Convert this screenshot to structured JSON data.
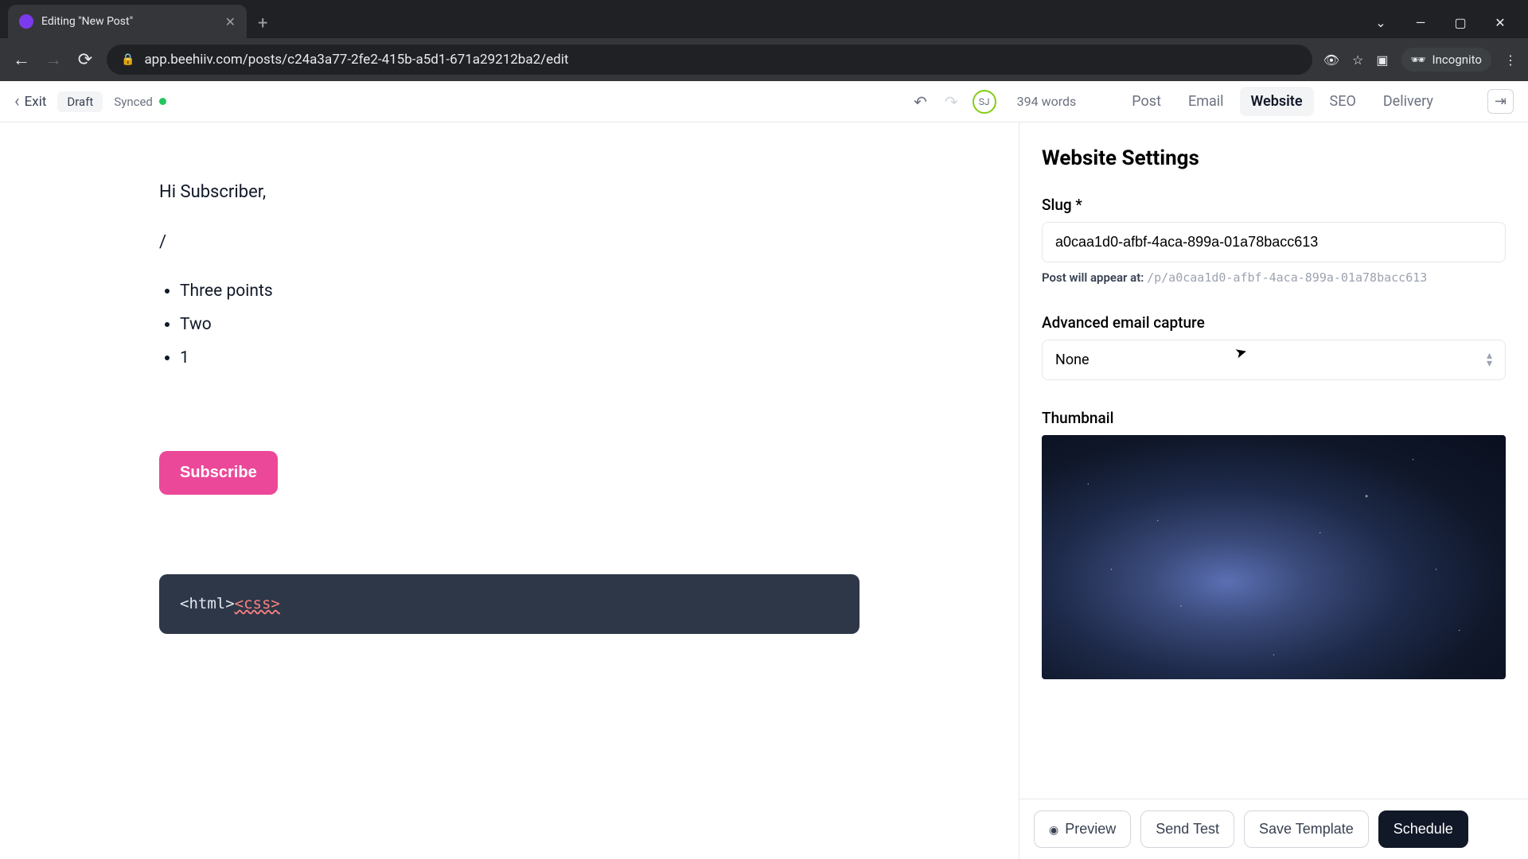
{
  "browser": {
    "tab_title": "Editing \"New Post\"",
    "url": "app.beehiiv.com/posts/c24a3a77-2fe2-415b-a5d1-671a29212ba2/edit",
    "incognito_label": "Incognito"
  },
  "toolbar": {
    "exit_label": "Exit",
    "draft_label": "Draft",
    "synced_label": "Synced",
    "avatar_initials": "SJ",
    "word_count": "394 words",
    "tabs": {
      "post": "Post",
      "email": "Email",
      "website": "Website",
      "seo": "SEO",
      "delivery": "Delivery"
    }
  },
  "editor": {
    "greeting": "Hi Subscriber,",
    "slash": "/",
    "bullets": [
      "Three points",
      "Two",
      "1"
    ],
    "subscribe_label": "Subscribe",
    "code_html": "<html>",
    "code_css": "<css>"
  },
  "sidebar": {
    "title": "Website Settings",
    "slug_label": "Slug *",
    "slug_value": "a0caa1d0-afbf-4aca-899a-01a78bacc613",
    "slug_hint_prefix": "Post will appear at:",
    "slug_hint_path": "/p/a0caa1d0-afbf-4aca-899a-01a78bacc613",
    "capture_label": "Advanced email capture",
    "capture_value": "None",
    "thumb_label": "Thumbnail"
  },
  "footer": {
    "preview": "Preview",
    "send_test": "Send Test",
    "save_template": "Save Template",
    "schedule": "Schedule"
  }
}
